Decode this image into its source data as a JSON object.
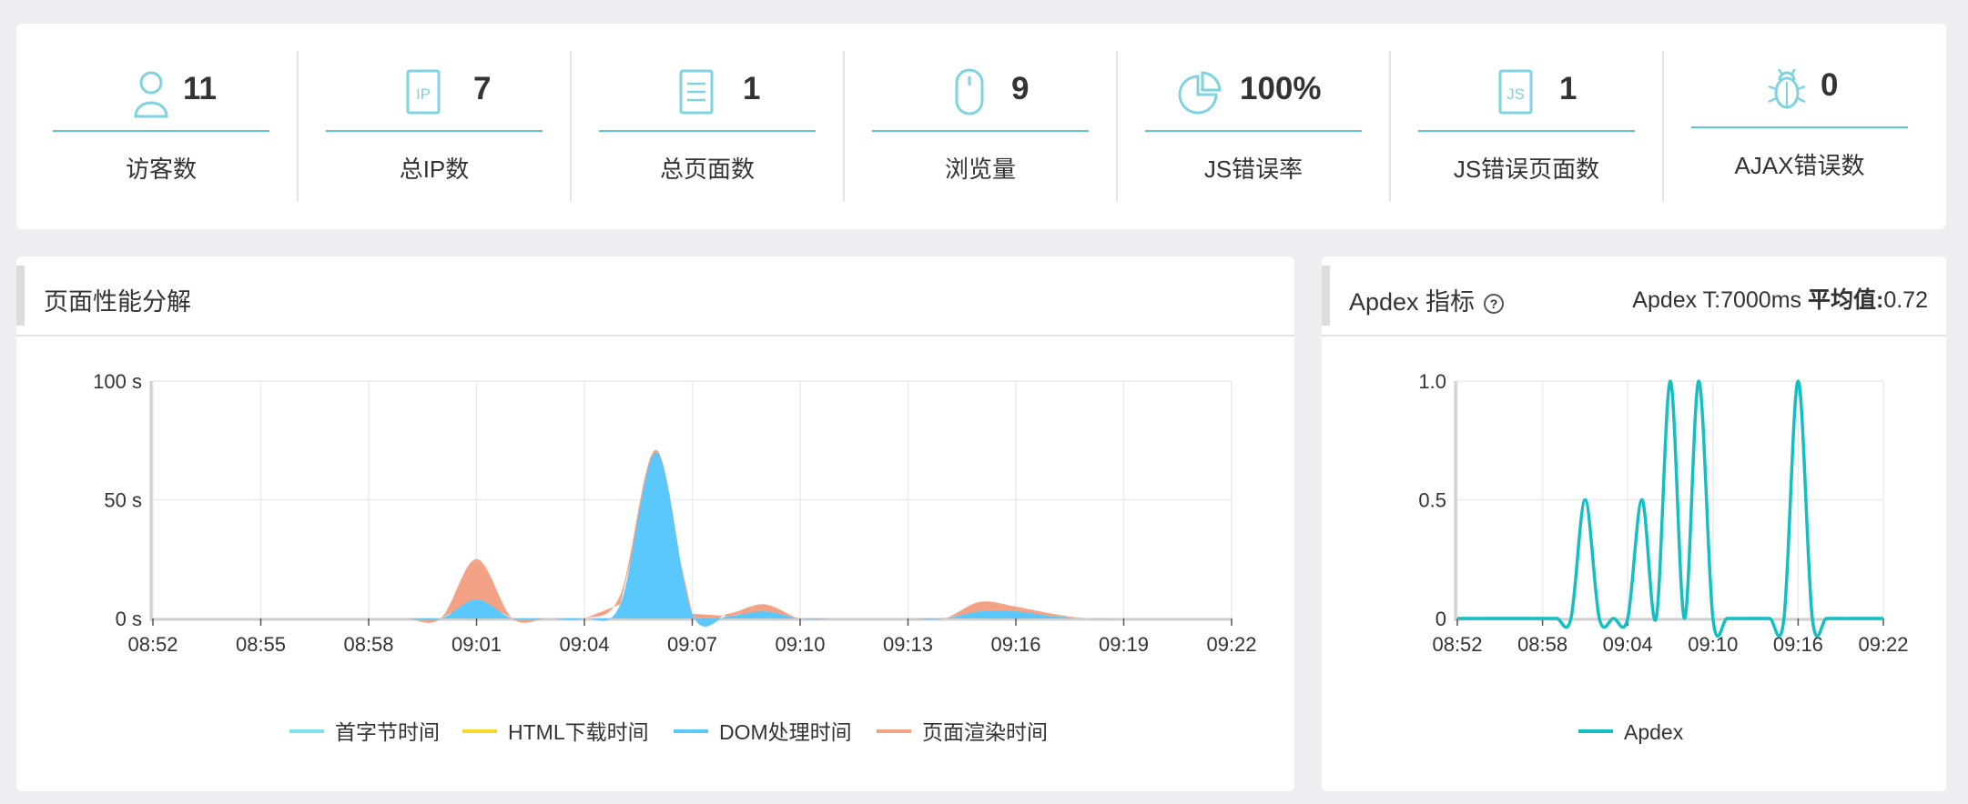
{
  "stats": [
    {
      "icon": "visitor-icon",
      "value": "11",
      "label": "访客数"
    },
    {
      "icon": "ip-icon",
      "value": "7",
      "label": "总IP数"
    },
    {
      "icon": "page-icon",
      "value": "1",
      "label": "总页面数"
    },
    {
      "icon": "mouse-icon",
      "value": "9",
      "label": "浏览量"
    },
    {
      "icon": "pie-icon",
      "value": "100%",
      "label": "JS错误率"
    },
    {
      "icon": "js-icon",
      "value": "1",
      "label": "JS错误页面数"
    },
    {
      "icon": "bug-icon",
      "value": "0",
      "label": "AJAX错误数"
    }
  ],
  "perf_panel": {
    "title": "页面性能分解"
  },
  "apdex_panel": {
    "title": "Apdex 指标",
    "help": "?",
    "threshold": "Apdex T:7000ms",
    "avg_label": "平均值:",
    "avg_value": "0.72"
  },
  "colors": {
    "accent": "#5cc4d6",
    "first_byte": "#7fe0ec",
    "html_download": "#f5d82a",
    "dom": "#5ac8fa",
    "render": "#f4a285",
    "apdex": "#14bfc2"
  },
  "chart_data": [
    {
      "type": "area",
      "stacked": true,
      "x": [
        "08:52",
        "08:53",
        "08:54",
        "08:55",
        "08:56",
        "08:57",
        "08:58",
        "08:59",
        "09:00",
        "09:01",
        "09:02",
        "09:03",
        "09:04",
        "09:05",
        "09:06",
        "09:07",
        "09:08",
        "09:09",
        "09:10",
        "09:11",
        "09:12",
        "09:13",
        "09:14",
        "09:15",
        "09:16",
        "09:17",
        "09:18",
        "09:19",
        "09:20",
        "09:21",
        "09:22"
      ],
      "xticks": [
        "08:52",
        "08:55",
        "08:58",
        "09:01",
        "09:04",
        "09:07",
        "09:10",
        "09:13",
        "09:16",
        "09:19",
        "09:22"
      ],
      "yticks": [
        "0 s",
        "50 s",
        "100 s"
      ],
      "ylim": [
        0,
        100
      ],
      "series": [
        {
          "name": "首字节时间",
          "color": "#7fe0ec",
          "values": [
            0,
            0,
            0,
            0,
            0,
            0,
            0,
            0,
            0,
            0,
            0,
            0,
            0,
            0,
            0,
            0,
            0,
            0,
            0,
            0,
            0,
            0,
            0,
            0,
            0,
            0,
            0,
            0,
            0,
            0,
            0
          ]
        },
        {
          "name": "HTML下载时间",
          "color": "#f5d82a",
          "values": [
            0,
            0,
            0,
            0,
            0,
            0,
            0,
            0,
            0,
            0,
            0,
            0,
            0,
            0,
            0,
            0,
            0,
            0,
            0,
            0,
            0,
            0,
            0,
            0,
            0,
            0,
            0,
            0,
            0,
            0,
            0
          ]
        },
        {
          "name": "DOM处理时间",
          "color": "#5ac8fa",
          "values": [
            0,
            0,
            0,
            0,
            0,
            0,
            0,
            0,
            0,
            8,
            0,
            0,
            0,
            6,
            70,
            2,
            1,
            3,
            0,
            0,
            0,
            0,
            0,
            3,
            3,
            1,
            0,
            0,
            0,
            0,
            0
          ]
        },
        {
          "name": "页面渲染时间",
          "color": "#f4a285",
          "values": [
            0,
            0,
            0,
            0,
            0,
            0,
            0,
            0,
            0,
            17,
            0,
            0,
            0,
            4,
            1,
            0,
            1,
            3,
            0,
            0,
            0,
            0,
            0,
            4,
            2,
            1,
            0,
            0,
            0,
            0,
            0
          ]
        }
      ]
    },
    {
      "type": "line",
      "x": [
        "08:52",
        "08:53",
        "08:54",
        "08:55",
        "08:56",
        "08:57",
        "08:58",
        "08:59",
        "09:00",
        "09:01",
        "09:02",
        "09:03",
        "09:04",
        "09:05",
        "09:06",
        "09:07",
        "09:08",
        "09:09",
        "09:10",
        "09:11",
        "09:12",
        "09:13",
        "09:14",
        "09:15",
        "09:16",
        "09:17",
        "09:18",
        "09:19",
        "09:20",
        "09:21",
        "09:22"
      ],
      "xticks": [
        "08:52",
        "08:58",
        "09:04",
        "09:10",
        "09:16",
        "09:22"
      ],
      "yticks": [
        "0",
        "0.5",
        "1.0"
      ],
      "ylim": [
        0,
        1
      ],
      "series": [
        {
          "name": "Apdex",
          "color": "#14bfc2",
          "values": [
            0,
            0,
            0,
            0,
            0,
            0,
            0,
            0,
            0,
            0.5,
            0,
            0,
            0,
            0.5,
            0,
            1,
            0,
            1,
            0,
            0,
            0,
            0,
            0,
            0,
            1,
            0,
            0,
            0,
            0,
            0,
            0
          ]
        }
      ]
    }
  ]
}
